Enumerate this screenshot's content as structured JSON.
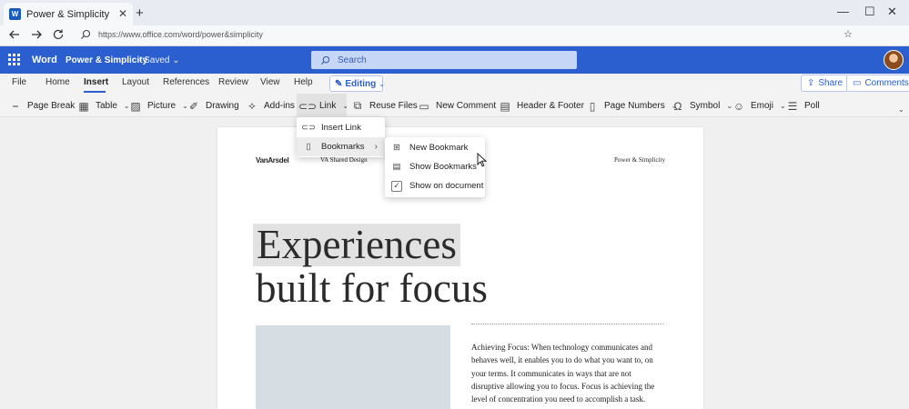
{
  "browser": {
    "tab_title": "Power & Simplicity",
    "tab_close": "✕",
    "new_tab": "+",
    "url": "https://www.office.com/word/power&simplicity",
    "window": {
      "minimize": "—",
      "maximize": "☐",
      "close": "✕"
    }
  },
  "app": {
    "name": "Word",
    "document_title": "Power & Simplicity",
    "save_status": "- Saved",
    "search_placeholder": "Search",
    "accent": "#2b5fcf"
  },
  "ribbon_tabs": {
    "items": [
      "File",
      "Home",
      "Insert",
      "Layout",
      "References",
      "Review",
      "View",
      "Help"
    ],
    "active": "Insert",
    "editing_label": "Editing",
    "share_label": "Share",
    "comments_label": "Comments"
  },
  "ribbon_commands": {
    "page_break": "Page Break",
    "table": "Table",
    "picture": "Picture",
    "drawing": "Drawing",
    "addins": "Add-ins",
    "link": "Link",
    "reuse_files": "Reuse Files",
    "new_comment": "New Comment",
    "header_footer": "Header & Footer",
    "page_numbers": "Page Numbers",
    "symbol": "Symbol",
    "emoji": "Emoji",
    "poll": "Poll"
  },
  "link_menu": {
    "insert_link": "Insert Link",
    "bookmarks": "Bookmarks"
  },
  "bookmarks_menu": {
    "new_bookmark": "New Bookmark",
    "show_bookmarks": "Show Bookmarks",
    "show_on_document": "Show on document",
    "show_on_document_checked": true
  },
  "document": {
    "header_logo": "VanArsdel",
    "header_center": "VA Shared Design",
    "header_right": "Power & Simplicity",
    "heading_line1": "Experiences",
    "heading_line2": "built for focus",
    "body": "Achieving Focus: When technology communicates and behaves well, it enables you to do what you want to, on your terms. It communicates in ways that are not disruptive allowing you to focus. Focus is achieving the level of concentration you need to accomplish a task."
  }
}
